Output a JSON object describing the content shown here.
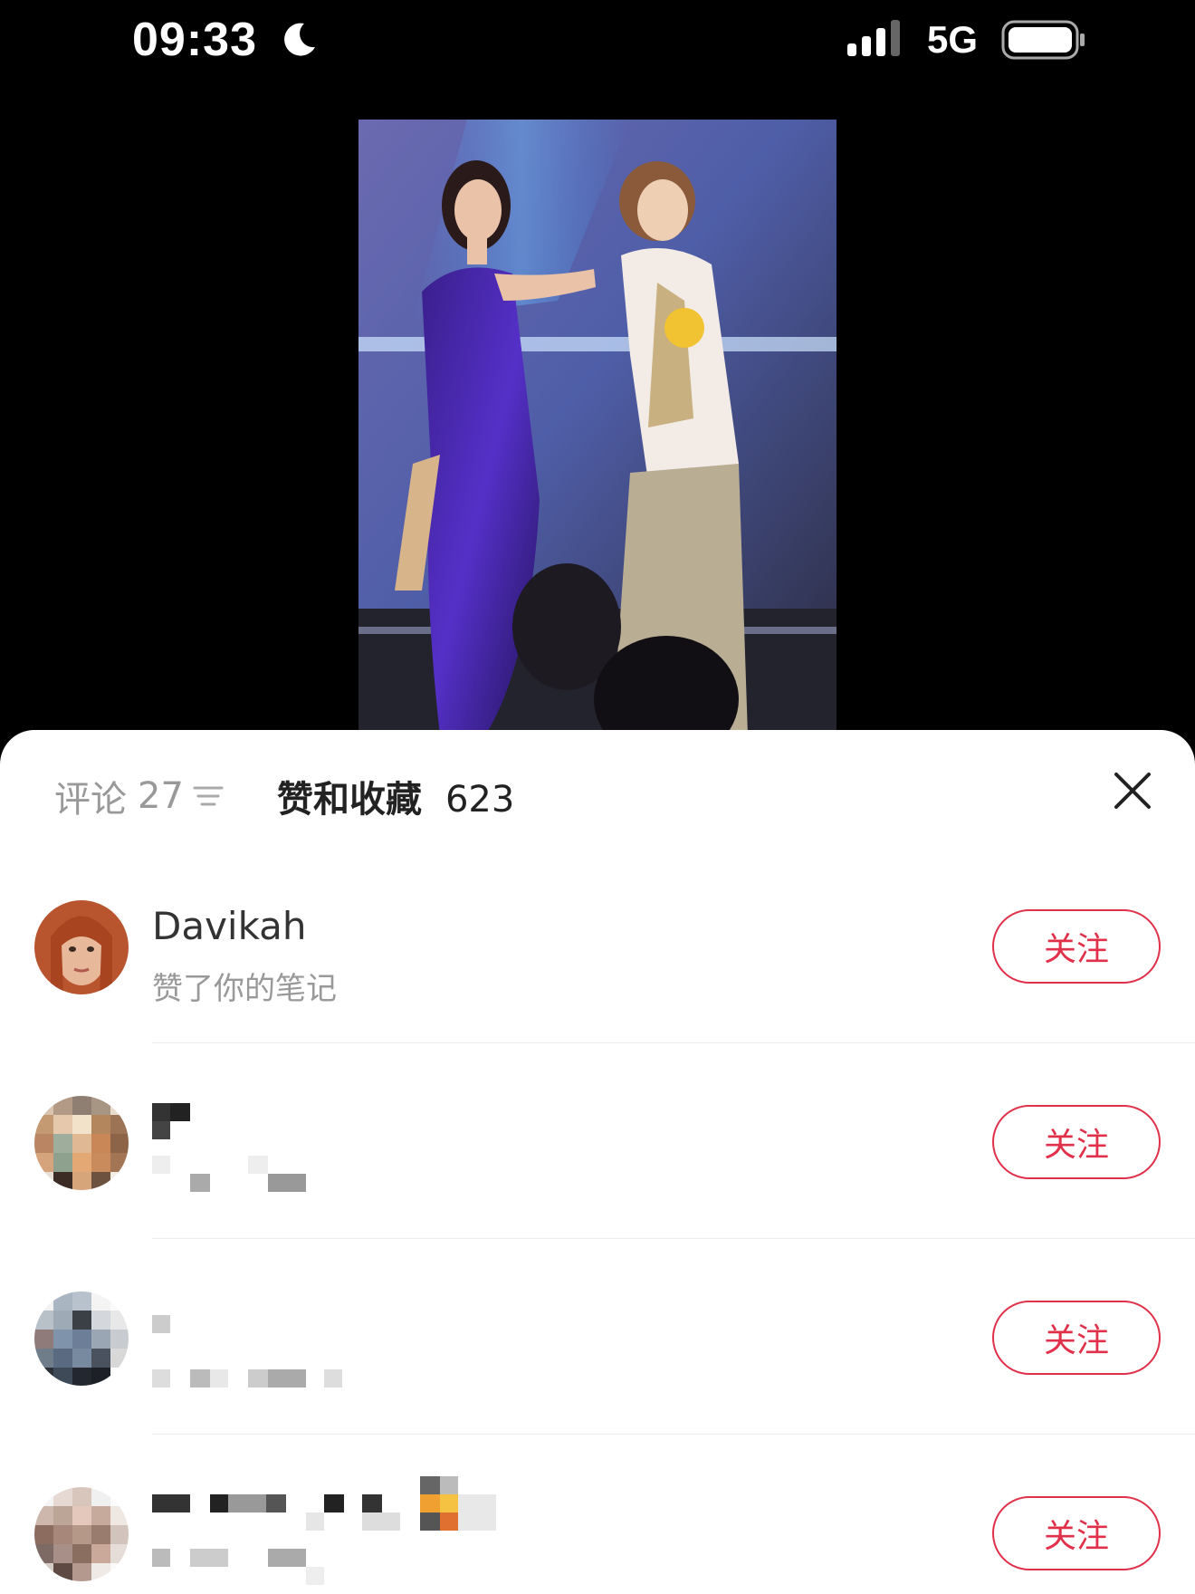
{
  "status": {
    "time": "09:33",
    "network": "5G",
    "icons": [
      "moon-icon",
      "signal-icon",
      "battery-icon"
    ]
  },
  "sheet": {
    "tab_comments_label": "评论",
    "tab_comments_count": "27",
    "tab_likes_label": "赞和收藏",
    "tab_likes_count": "623",
    "close_icon": "close-icon"
  },
  "likes": [
    {
      "name": "Davikah",
      "action": "赞了你的笔记",
      "follow_label": "关注"
    },
    {
      "name": "",
      "action": "",
      "follow_label": "关注"
    },
    {
      "name": "",
      "action": "",
      "follow_label": "关注"
    },
    {
      "name": "",
      "action": "",
      "follow_label": "关注"
    }
  ],
  "colors": {
    "accent": "#e0304a",
    "background": "#000000",
    "sheet": "#ffffff"
  }
}
